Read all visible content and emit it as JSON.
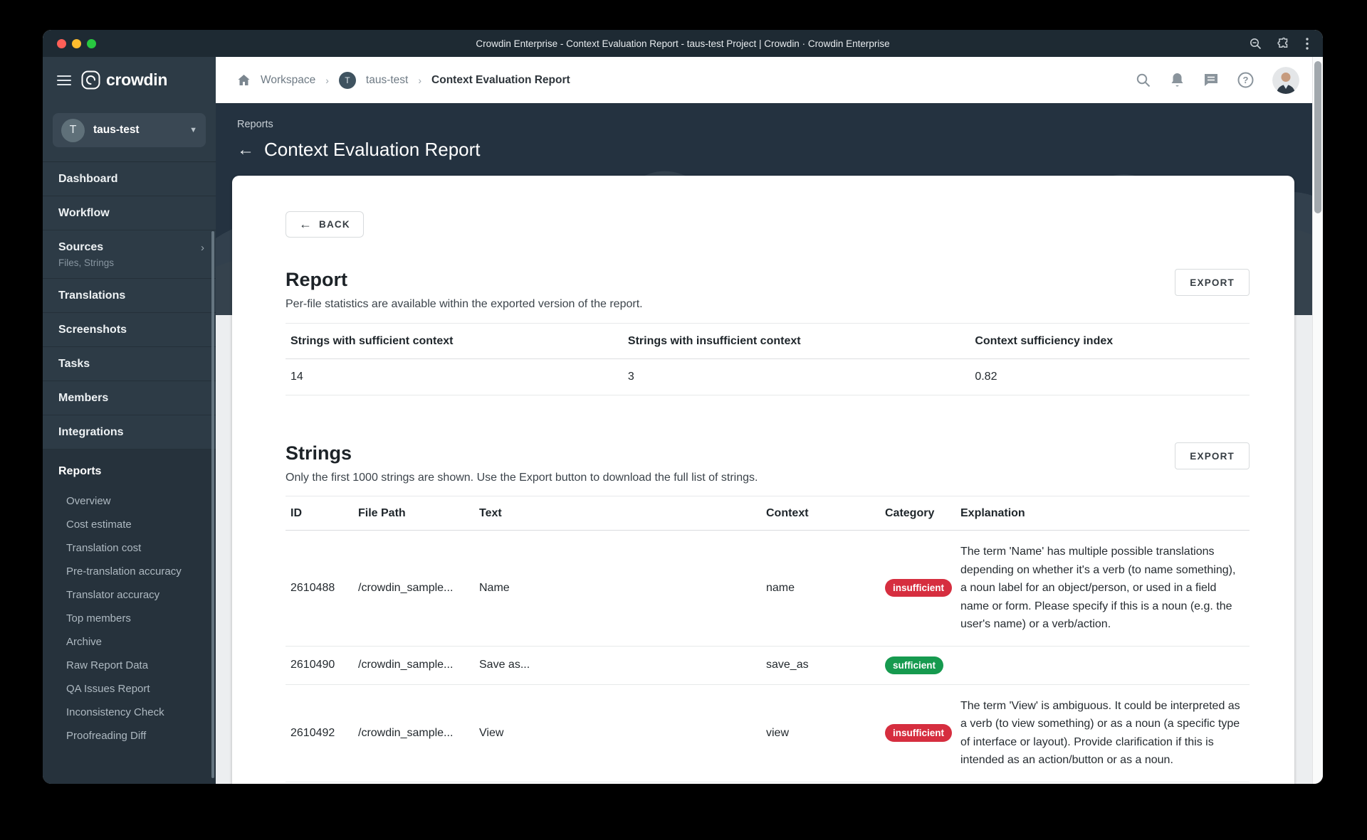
{
  "titlebar": {
    "title": "Crowdin Enterprise - Context Evaluation Report - taus-test Project | Crowdin · Crowdin Enterprise"
  },
  "colors": {
    "badge_insufficient": "#d62e3f",
    "badge_sufficient": "#169a4f",
    "hero_bg": "#243240",
    "sidebar_bg": "#2d3b46"
  },
  "sidebar": {
    "logo_text": "crowdin",
    "project": {
      "initial": "T",
      "name": "taus-test"
    },
    "items": [
      {
        "label": "Dashboard",
        "sublabel": "",
        "chevron": false
      },
      {
        "label": "Workflow",
        "sublabel": "",
        "chevron": false
      },
      {
        "label": "Sources",
        "sublabel": "Files, Strings",
        "chevron": true
      },
      {
        "label": "Translations",
        "sublabel": "",
        "chevron": false
      },
      {
        "label": "Screenshots",
        "sublabel": "",
        "chevron": false
      },
      {
        "label": "Tasks",
        "sublabel": "",
        "chevron": false
      },
      {
        "label": "Members",
        "sublabel": "",
        "chevron": false
      },
      {
        "label": "Integrations",
        "sublabel": "",
        "chevron": false
      }
    ],
    "reports_label": "Reports",
    "report_items": [
      "Overview",
      "Cost estimate",
      "Translation cost",
      "Pre-translation accuracy",
      "Translator accuracy",
      "Top members",
      "Archive",
      "Raw Report Data",
      "QA Issues Report",
      "Inconsistency Check",
      "Proofreading Diff"
    ]
  },
  "header": {
    "breadcrumb": {
      "workspace": "Workspace",
      "project_initial": "T",
      "project": "taus-test",
      "page": "Context Evaluation Report"
    }
  },
  "hero": {
    "eyebrow": "Reports",
    "back_arrow": "←",
    "title": "Context Evaluation Report"
  },
  "content": {
    "back_label": "BACK",
    "report": {
      "heading": "Report",
      "description": "Per-file statistics are available within the exported version of the report.",
      "export_label": "EXPORT",
      "stats": [
        {
          "label": "Strings with sufficient context",
          "value": "14"
        },
        {
          "label": "Strings with insufficient context",
          "value": "3"
        },
        {
          "label": "Context sufficiency index",
          "value": "0.82"
        }
      ]
    },
    "strings": {
      "heading": "Strings",
      "description": "Only the first 1000 strings are shown. Use the Export button to download the full list of strings.",
      "export_label": "EXPORT",
      "columns": [
        "ID",
        "File Path",
        "Text",
        "Context",
        "Category",
        "Explanation"
      ],
      "rows": [
        {
          "id": "2610488",
          "file": "/crowdin_sample...",
          "text": "Name",
          "context": "name",
          "category": "insufficient",
          "explanation": "The term 'Name' has multiple possible translations depending on whether it's a verb (to name something), a noun label for an object/person, or used in a field name or form. Please specify if this is a noun (e.g. the user's name) or a verb/action."
        },
        {
          "id": "2610490",
          "file": "/crowdin_sample...",
          "text": "Save as...",
          "context": "save_as",
          "category": "sufficient",
          "explanation": ""
        },
        {
          "id": "2610492",
          "file": "/crowdin_sample...",
          "text": "View",
          "context": "view",
          "category": "insufficient",
          "explanation": "The term 'View' is ambiguous. It could be interpreted as a verb (to view something) or as a noun (a specific type of interface or layout). Provide clarification if this is intended as an action/button or as a noun."
        }
      ]
    }
  }
}
